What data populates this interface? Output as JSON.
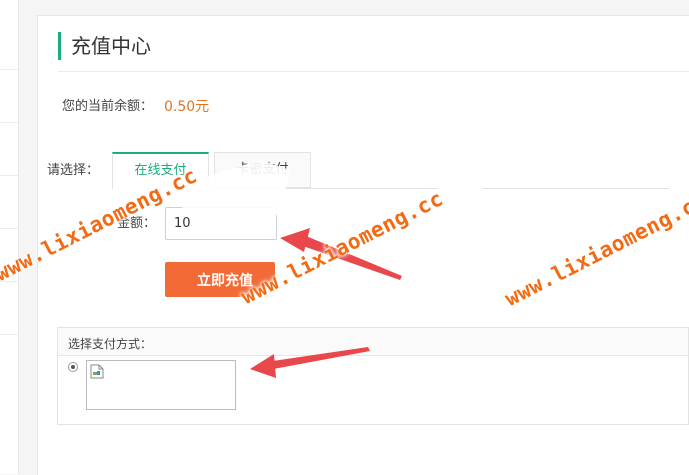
{
  "page": {
    "title": "充值中心",
    "balance_label": "您的当前余额：",
    "balance_value": "0.50元"
  },
  "recharge": {
    "choose_label": "请选择：",
    "tabs": [
      {
        "label": "在线支付",
        "active": true
      },
      {
        "label": "卡密支付",
        "active": false
      }
    ],
    "amount_label": "金额：",
    "amount_value": "10",
    "submit_label": "立即充值"
  },
  "payment": {
    "title": "选择支付方式：",
    "selected": true
  },
  "watermark": "www.lixiaomeng.cc",
  "colors": {
    "accent": "#1aaf7a",
    "price": "#e0741f",
    "button": "#f26a38",
    "watermark": "#f46a12",
    "arrow": "#e8474b"
  }
}
